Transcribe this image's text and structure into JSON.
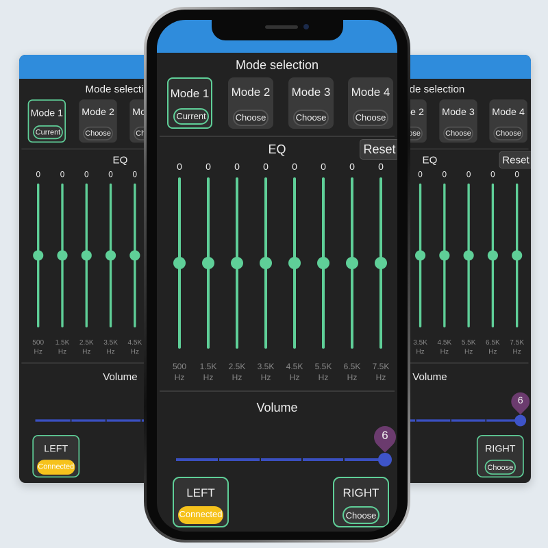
{
  "colors": {
    "header": "#2f8cdc",
    "accent": "#5fcf98",
    "background": "#222222",
    "volume": "#3e54c8",
    "pin": "#6b3b6e",
    "connected": "#f6c21c"
  },
  "mode_section": {
    "title": "Mode selection",
    "modes": [
      {
        "label": "Mode 1",
        "button": "Current",
        "selected": true
      },
      {
        "label": "Mode 2",
        "button": "Choose"
      },
      {
        "label": "Mode 3",
        "button": "Choose"
      },
      {
        "label": "Mode 4",
        "button": "Choose"
      }
    ]
  },
  "eq": {
    "title": "EQ",
    "reset": "Reset",
    "bands": [
      {
        "value": "0",
        "freq": "500",
        "unit": "Hz"
      },
      {
        "value": "0",
        "freq": "1.5K",
        "unit": "Hz"
      },
      {
        "value": "0",
        "freq": "2.5K",
        "unit": "Hz"
      },
      {
        "value": "0",
        "freq": "3.5K",
        "unit": "Hz"
      },
      {
        "value": "0",
        "freq": "4.5K",
        "unit": "Hz"
      },
      {
        "value": "0",
        "freq": "5.5K",
        "unit": "Hz"
      },
      {
        "value": "0",
        "freq": "6.5K",
        "unit": "Hz"
      },
      {
        "value": "0",
        "freq": "7.5K",
        "unit": "Hz"
      }
    ]
  },
  "volume": {
    "title": "Volume",
    "value": "6",
    "level_fraction": 1.0
  },
  "channels": {
    "left": {
      "label": "LEFT",
      "status": "Connected"
    },
    "right": {
      "label": "RIGHT",
      "status": "Choose"
    }
  }
}
